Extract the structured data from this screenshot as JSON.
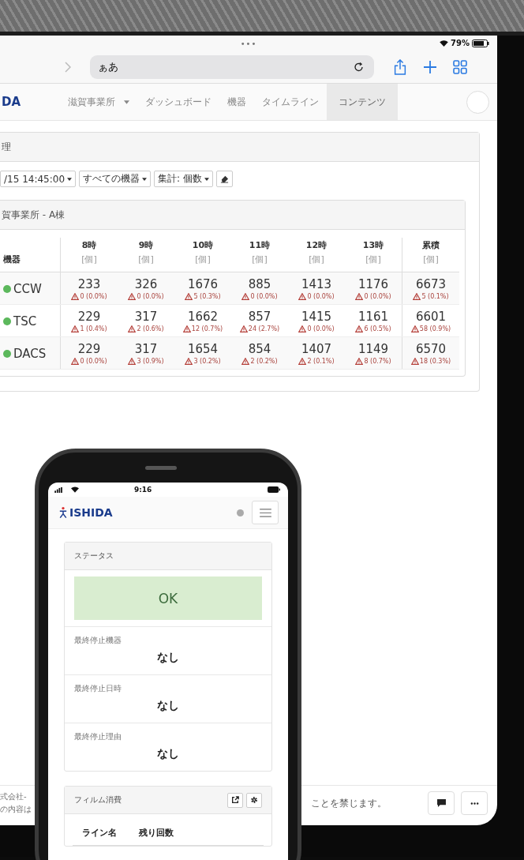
{
  "status_bar": {
    "dots": "•••",
    "battery": "79%"
  },
  "browser": {
    "address": "ぁあ"
  },
  "nav": {
    "logo": "DA",
    "items": [
      {
        "label": "滋賀事業所",
        "dropdown": true,
        "selected": false
      },
      {
        "label": "ダッシュボード",
        "dropdown": false,
        "selected": false
      },
      {
        "label": "機器",
        "dropdown": false,
        "selected": false
      },
      {
        "label": "タイムライン",
        "dropdown": false,
        "selected": false
      },
      {
        "label": "コンテンツ",
        "dropdown": false,
        "selected": true
      }
    ]
  },
  "panel": {
    "title": "理",
    "toolbar": [
      {
        "kind": "dropdown",
        "label": "/15 14:45:00"
      },
      {
        "kind": "dropdown",
        "label": "すべての機器"
      },
      {
        "kind": "dropdown",
        "label": "集計: 個数"
      },
      {
        "kind": "icon"
      }
    ],
    "section": {
      "title": "賀事業所 - A棟",
      "device_header": "機器",
      "columns": [
        {
          "label": "8時",
          "unit": "[個]"
        },
        {
          "label": "9時",
          "unit": "[個]"
        },
        {
          "label": "10時",
          "unit": "[個]"
        },
        {
          "label": "11時",
          "unit": "[個]"
        },
        {
          "label": "12時",
          "unit": "[個]"
        },
        {
          "label": "13時",
          "unit": "[個]"
        },
        {
          "label": "累積",
          "unit": "[個]"
        }
      ],
      "rows": [
        {
          "device": "CCW",
          "color": "#5cb85c",
          "cells": [
            {
              "count": "233",
              "errors": "0 (0.0%)"
            },
            {
              "count": "326",
              "errors": "0 (0.0%)"
            },
            {
              "count": "1676",
              "errors": "5 (0.3%)"
            },
            {
              "count": "885",
              "errors": "0 (0.0%)"
            },
            {
              "count": "1413",
              "errors": "0 (0.0%)"
            },
            {
              "count": "1176",
              "errors": "0 (0.0%)"
            },
            {
              "count": "6673",
              "errors": "5 (0.1%)"
            }
          ]
        },
        {
          "device": "TSC",
          "color": "#5cb85c",
          "cells": [
            {
              "count": "229",
              "errors": "1 (0.4%)"
            },
            {
              "count": "317",
              "errors": "2 (0.6%)"
            },
            {
              "count": "1662",
              "errors": "12 (0.7%)"
            },
            {
              "count": "857",
              "errors": "24 (2.7%)"
            },
            {
              "count": "1415",
              "errors": "0 (0.0%)"
            },
            {
              "count": "1161",
              "errors": "6 (0.5%)"
            },
            {
              "count": "6601",
              "errors": "58 (0.9%)"
            }
          ]
        },
        {
          "device": "DACS",
          "color": "#5cb85c",
          "cells": [
            {
              "count": "229",
              "errors": "0 (0.0%)"
            },
            {
              "count": "317",
              "errors": "3 (0.9%)"
            },
            {
              "count": "1654",
              "errors": "3 (0.2%)"
            },
            {
              "count": "854",
              "errors": "2 (0.2%)"
            },
            {
              "count": "1407",
              "errors": "2 (0.1%)"
            },
            {
              "count": "1149",
              "errors": "8 (0.7%)"
            },
            {
              "count": "6570",
              "errors": "18 (0.3%)"
            }
          ]
        }
      ]
    }
  },
  "footer": {
    "left_lines": [
      "式会社-",
      "の内容は"
    ],
    "right_text": "ことを禁じます。"
  },
  "phone": {
    "time": "9:16",
    "logo": "ISHIDA",
    "status": {
      "title": "ステータス",
      "result": "OK",
      "kind": "ok",
      "fields": [
        {
          "label": "最終停止機器",
          "value": "なし"
        },
        {
          "label": "最終停止日時",
          "value": "なし"
        },
        {
          "label": "最終停止理由",
          "value": "なし"
        }
      ]
    },
    "film": {
      "title": "フィルム消費",
      "columns": [
        "ライン名",
        "残り回数"
      ]
    }
  }
}
